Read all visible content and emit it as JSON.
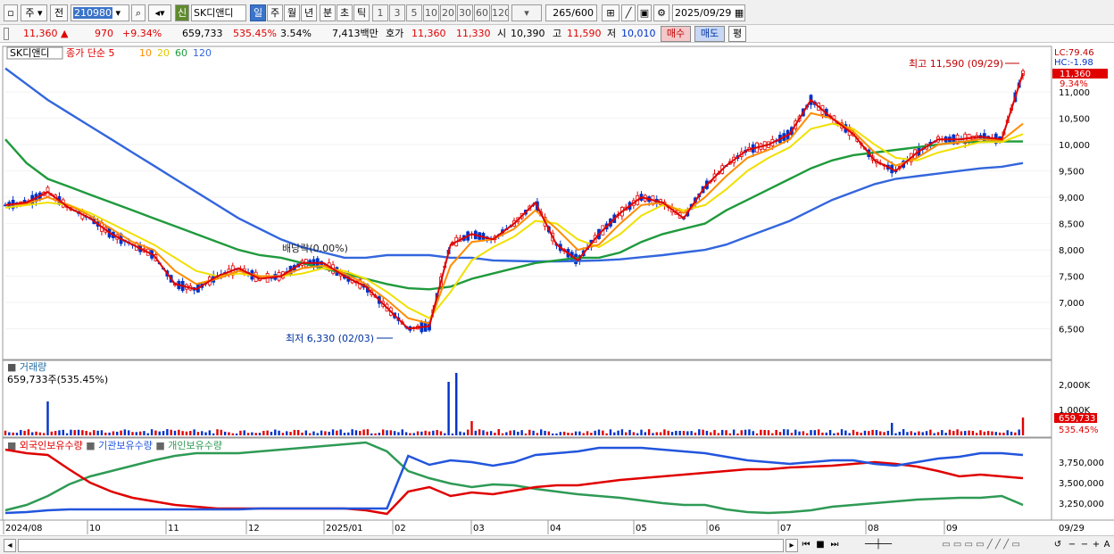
{
  "toolbar": {
    "type_value": "주",
    "prev_label": "전",
    "stock_code": "210980",
    "badge_label": "신",
    "stock_name": "SK디앤디",
    "periods": [
      "일",
      "주",
      "월",
      "년",
      "분",
      "초",
      "틱"
    ],
    "intervals": [
      "1",
      "3",
      "5",
      "10",
      "20",
      "30",
      "60",
      "120"
    ],
    "count": "265",
    "count_total": "/600",
    "date": "2025/09/29"
  },
  "infobar": {
    "price": "11,360",
    "change": "970",
    "change_pct": "+9.34%",
    "volume": "659,733",
    "volume_pct": "535.45%",
    "turnover": "3.54%",
    "amount": "7,413백만",
    "quote_label": "호가",
    "ask": "11,360",
    "bid": "11,330",
    "open_label": "시",
    "open": "10,390",
    "high_label": "고",
    "high": "11,590",
    "low_label": "저",
    "low": "10,010",
    "buy_label": "매수",
    "sell_label": "매도",
    "avg_label": "평"
  },
  "legend": {
    "stock_tag": "SK디앤디",
    "price_label": "종가 단순",
    "ma5": "5",
    "ma10": "10",
    "ma20": "20",
    "ma60": "60",
    "ma120": "120"
  },
  "annotations": {
    "high_mark": "최고 11,590 (09/29)",
    "low_mark": "최저 6,330 (02/03)",
    "dividend": "배당락(0.00%)",
    "lc": "LC:79.46",
    "hc": "HC:-1.98",
    "last_price": "11,360",
    "last_pct": "9.34%"
  },
  "volume_panel": {
    "title": "거래량",
    "readout": "659,733주(535.45%)",
    "axis": [
      "2,000K",
      "1,000K"
    ],
    "last_value": "659,733",
    "last_pct": "535.45%"
  },
  "holding_panel": {
    "legend": [
      "외국인보유수량",
      "기관보유수량",
      "개인보유수량"
    ],
    "axis": [
      "3,750,000",
      "3,500,000",
      "3,250,000"
    ]
  },
  "x_axis": {
    "labels": [
      "2024/08",
      "10",
      "11",
      "12",
      "2025/01",
      "02",
      "03",
      "04",
      "05",
      "06",
      "07",
      "08",
      "09"
    ],
    "last_label": "09/29"
  },
  "colors": {
    "up": "#e00000",
    "down": "#0032c8",
    "ma5": "#e00000",
    "ma10": "#ff8c00",
    "ma20": "#f0e000",
    "ma60": "#1e9a3c",
    "ma120": "#3366dd",
    "foreign": "#e00000",
    "institution": "#2255dd",
    "individual": "#2e9a55"
  },
  "chart_data": {
    "type": "line",
    "title": "",
    "xlabel": "",
    "ylabel": "",
    "ylim": [
      6000,
      11800
    ],
    "y_ticks": [
      6500,
      7000,
      7500,
      8000,
      8500,
      9000,
      9500,
      10000,
      10500,
      11000
    ],
    "x_ticks": [
      "2024/08",
      "10",
      "11",
      "12",
      "2025/01",
      "02",
      "03",
      "04",
      "05",
      "06",
      "07",
      "08",
      "09"
    ],
    "series": [
      {
        "name": "5",
        "values": [
          8850,
          8900,
          9100,
          8800,
          8600,
          8300,
          8100,
          7900,
          7350,
          7250,
          7500,
          7650,
          7450,
          7500,
          7750,
          7750,
          7500,
          7300,
          6900,
          6500,
          6550,
          8100,
          8300,
          8200,
          8500,
          8900,
          8100,
          7800,
          8300,
          8700,
          9000,
          8900,
          8600,
          9200,
          9600,
          9900,
          10000,
          10200,
          10850,
          10500,
          10200,
          9700,
          9500,
          9850,
          10100,
          10100,
          10150,
          10100,
          11360
        ]
      },
      {
        "name": "10",
        "values": [
          8850,
          8880,
          9000,
          8850,
          8650,
          8400,
          8150,
          8000,
          7600,
          7350,
          7450,
          7600,
          7500,
          7500,
          7650,
          7700,
          7550,
          7350,
          7050,
          6700,
          6600,
          7700,
          8150,
          8200,
          8400,
          8750,
          8400,
          8000,
          8100,
          8500,
          8850,
          8900,
          8700,
          9000,
          9400,
          9750,
          9900,
          10100,
          10600,
          10500,
          10250,
          9850,
          9600,
          9750,
          10000,
          10050,
          10100,
          10080,
          10400
        ]
      },
      {
        "name": "20",
        "values": [
          8800,
          8850,
          8900,
          8850,
          8700,
          8500,
          8300,
          8100,
          7850,
          7600,
          7500,
          7550,
          7500,
          7500,
          7550,
          7650,
          7600,
          7450,
          7200,
          6900,
          6700,
          7200,
          7800,
          8050,
          8250,
          8550,
          8500,
          8200,
          8050,
          8300,
          8650,
          8850,
          8750,
          8850,
          9150,
          9500,
          9750,
          9950,
          10300,
          10400,
          10300,
          10000,
          9750,
          9700,
          9850,
          9950,
          10050,
          10050,
          10200
        ]
      },
      {
        "name": "60",
        "values": [
          10100,
          9650,
          9350,
          9200,
          9050,
          8900,
          8750,
          8600,
          8450,
          8300,
          8150,
          8000,
          7900,
          7850,
          7750,
          7650,
          7550,
          7450,
          7350,
          7270,
          7250,
          7300,
          7450,
          7550,
          7650,
          7750,
          7800,
          7850,
          7850,
          7950,
          8150,
          8300,
          8400,
          8500,
          8750,
          8950,
          9150,
          9350,
          9550,
          9700,
          9800,
          9850,
          9900,
          9950,
          10000,
          10050,
          10050,
          10060,
          10060
        ]
      },
      {
        "name": "120",
        "values": [
          11450,
          11150,
          10850,
          10600,
          10350,
          10100,
          9850,
          9600,
          9350,
          9100,
          8850,
          8600,
          8400,
          8200,
          8050,
          7950,
          7850,
          7850,
          7900,
          7900,
          7900,
          7850,
          7850,
          7800,
          7790,
          7780,
          7780,
          7790,
          7800,
          7820,
          7860,
          7900,
          7950,
          8000,
          8100,
          8250,
          8400,
          8550,
          8750,
          8950,
          9100,
          9250,
          9350,
          9400,
          9450,
          9500,
          9550,
          9580,
          9650
        ]
      }
    ]
  }
}
